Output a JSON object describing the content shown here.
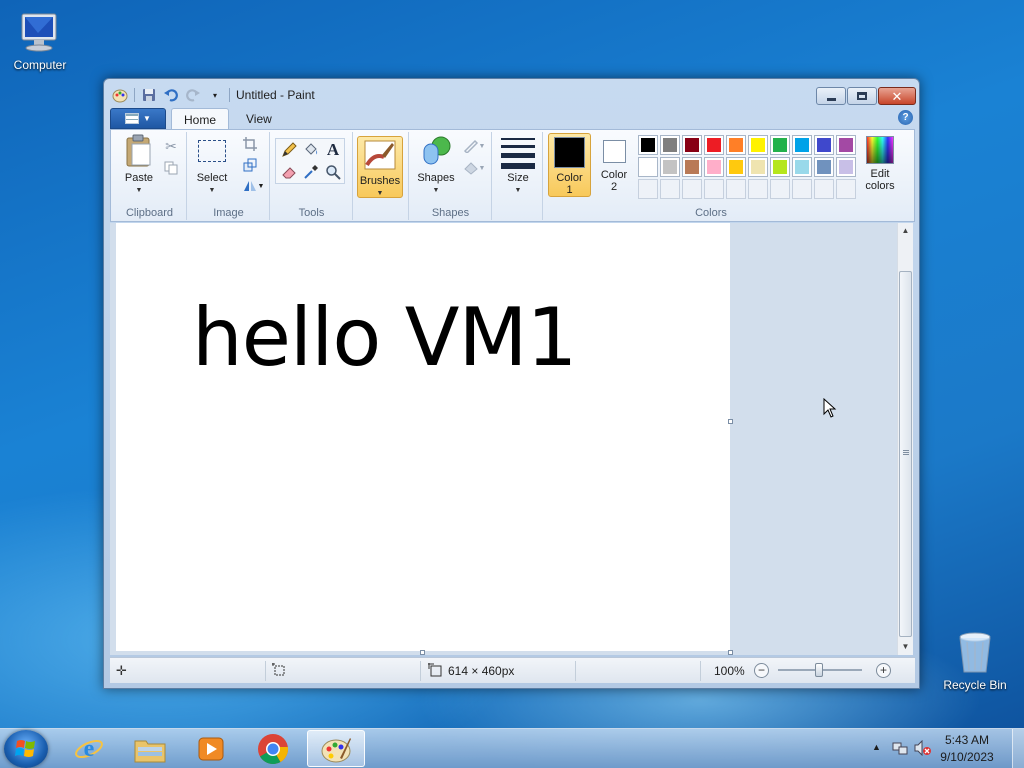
{
  "desktop": {
    "icons": [
      {
        "label": "Computer"
      },
      {
        "label": "Recycle Bin"
      }
    ]
  },
  "window": {
    "title": "Untitled - Paint",
    "tabs": [
      {
        "label": "Home",
        "active": true
      },
      {
        "label": "View",
        "active": false
      }
    ]
  },
  "ribbon": {
    "groups": {
      "clipboard": "Clipboard",
      "image": "Image",
      "tools": "Tools",
      "shapes": "Shapes",
      "colors": "Colors"
    },
    "buttons": {
      "paste": "Paste",
      "select": "Select",
      "brushes": "Brushes",
      "shapes": "Shapes",
      "size": "Size",
      "color1_line1": "Color",
      "color1_line2": "1",
      "color2_line1": "Color",
      "color2_line2": "2",
      "edit_colors_line1": "Edit",
      "edit_colors_line2": "colors"
    },
    "color1": "#000000",
    "color2": "#ffffff",
    "palette": [
      "#000000",
      "#7f7f7f",
      "#880015",
      "#ed1c24",
      "#ff7f27",
      "#fff200",
      "#22b14c",
      "#00a2e8",
      "#3f48cc",
      "#a349a4",
      "#ffffff",
      "#c3c3c3",
      "#b97a57",
      "#ffaec9",
      "#ffc90e",
      "#efe4b0",
      "#b5e61d",
      "#99d9ea",
      "#7092be",
      "#c8bfe7",
      "",
      "",
      "",
      "",
      "",
      "",
      "",
      "",
      "",
      ""
    ]
  },
  "canvas": {
    "text": "hello VM1",
    "background": "#ffffff"
  },
  "statusbar": {
    "dimensions": "614 × 460px",
    "zoom": "100%"
  },
  "taskbar": {
    "apps": [
      {
        "name": "internet-explorer"
      },
      {
        "name": "file-explorer"
      },
      {
        "name": "media-player"
      },
      {
        "name": "chrome"
      },
      {
        "name": "paint",
        "active": true
      }
    ],
    "time": "5:43 AM",
    "date": "9/10/2023"
  }
}
